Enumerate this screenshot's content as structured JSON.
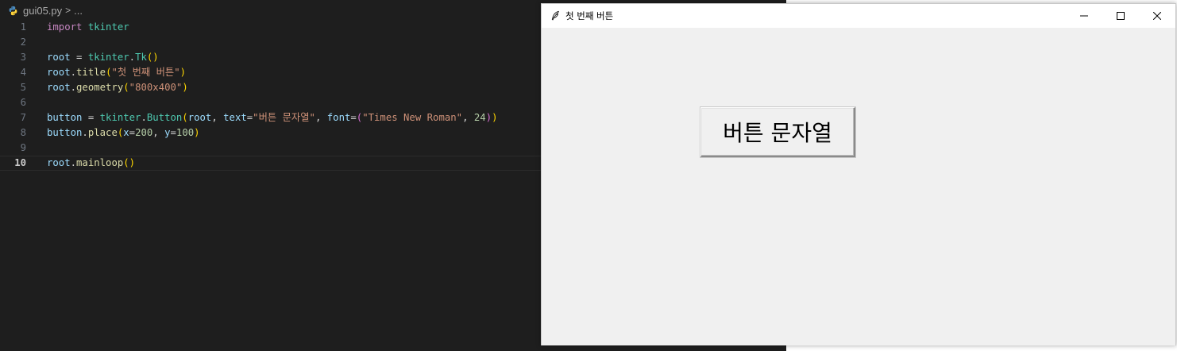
{
  "editor": {
    "breadcrumb": {
      "file": "gui05.py",
      "separator": ">",
      "trail": "..."
    },
    "lines": [
      {
        "n": "1",
        "tokens": [
          [
            "kw",
            "import"
          ],
          [
            "op",
            " "
          ],
          [
            "mod",
            "tkinter"
          ]
        ]
      },
      {
        "n": "2",
        "tokens": []
      },
      {
        "n": "3",
        "tokens": [
          [
            "var",
            "root"
          ],
          [
            "op",
            " = "
          ],
          [
            "mod",
            "tkinter"
          ],
          [
            "op",
            "."
          ],
          [
            "mod",
            "Tk"
          ],
          [
            "p1",
            "()"
          ]
        ]
      },
      {
        "n": "4",
        "tokens": [
          [
            "var",
            "root"
          ],
          [
            "op",
            "."
          ],
          [
            "fn",
            "title"
          ],
          [
            "p1",
            "("
          ],
          [
            "str",
            "\"첫 번째 버튼\""
          ],
          [
            "p1",
            ")"
          ]
        ]
      },
      {
        "n": "5",
        "tokens": [
          [
            "var",
            "root"
          ],
          [
            "op",
            "."
          ],
          [
            "fn",
            "geometry"
          ],
          [
            "p1",
            "("
          ],
          [
            "str",
            "\"800x400\""
          ],
          [
            "p1",
            ")"
          ]
        ]
      },
      {
        "n": "6",
        "tokens": []
      },
      {
        "n": "7",
        "tokens": [
          [
            "var",
            "button"
          ],
          [
            "op",
            " = "
          ],
          [
            "mod",
            "tkinter"
          ],
          [
            "op",
            "."
          ],
          [
            "mod",
            "Button"
          ],
          [
            "p1",
            "("
          ],
          [
            "var",
            "root"
          ],
          [
            "op",
            ", "
          ],
          [
            "var",
            "text"
          ],
          [
            "op",
            "="
          ],
          [
            "str",
            "\"버튼 문자열\""
          ],
          [
            "op",
            ", "
          ],
          [
            "var",
            "font"
          ],
          [
            "op",
            "="
          ],
          [
            "p2",
            "("
          ],
          [
            "str",
            "\"Times New Roman\""
          ],
          [
            "op",
            ", "
          ],
          [
            "num",
            "24"
          ],
          [
            "p2",
            ")"
          ],
          [
            "p1",
            ")"
          ]
        ]
      },
      {
        "n": "8",
        "tokens": [
          [
            "var",
            "button"
          ],
          [
            "op",
            "."
          ],
          [
            "fn",
            "place"
          ],
          [
            "p1",
            "("
          ],
          [
            "var",
            "x"
          ],
          [
            "op",
            "="
          ],
          [
            "num",
            "200"
          ],
          [
            "op",
            ", "
          ],
          [
            "var",
            "y"
          ],
          [
            "op",
            "="
          ],
          [
            "num",
            "100"
          ],
          [
            "p1",
            ")"
          ]
        ]
      },
      {
        "n": "9",
        "tokens": []
      },
      {
        "n": "10",
        "tokens": [
          [
            "var",
            "root"
          ],
          [
            "op",
            "."
          ],
          [
            "fn",
            "mainloop"
          ],
          [
            "p1",
            "()"
          ]
        ],
        "active": true
      }
    ]
  },
  "tk_window": {
    "title": "첫 번째 버튼",
    "button_label": "버튼 문자열",
    "controls": [
      "minimize-icon",
      "maximize-icon",
      "close-icon"
    ]
  },
  "colors": {
    "editor_bg": "#1e1e1e",
    "keyword": "#c586c0",
    "module": "#4ec9b0",
    "variable": "#9cdcfe",
    "function": "#dcdcaa",
    "string": "#ce9178",
    "number": "#b5cea8",
    "tk_bg": "#f0f0f0"
  }
}
